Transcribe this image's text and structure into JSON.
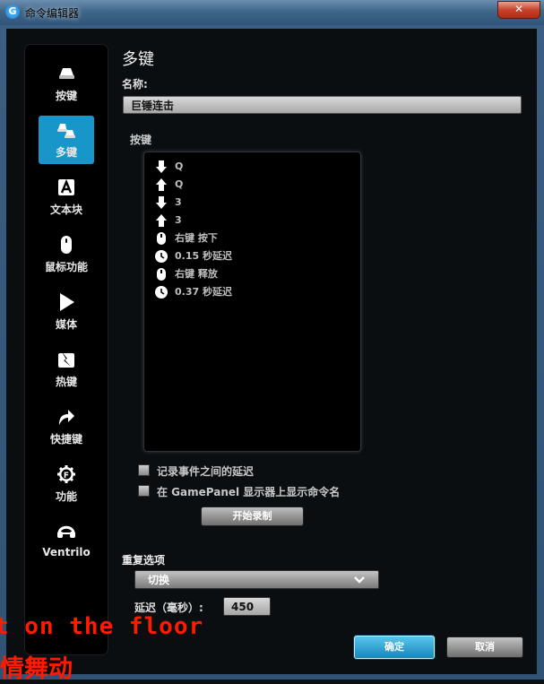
{
  "window": {
    "title": "命令编辑器",
    "logo": "G",
    "close": "✕"
  },
  "nav": [
    {
      "label": "按键",
      "icon": "key-icon",
      "selected": false
    },
    {
      "label": "多键",
      "icon": "multikey-icon",
      "selected": true
    },
    {
      "label": "文本块",
      "icon": "text-block-icon",
      "selected": false
    },
    {
      "label": "鼠标功能",
      "icon": "mouse-icon",
      "selected": false
    },
    {
      "label": "媒体",
      "icon": "play-icon",
      "selected": false
    },
    {
      "label": "热键",
      "icon": "hotkey-icon",
      "selected": false
    },
    {
      "label": "快捷键",
      "icon": "shortcut-arrow-icon",
      "selected": false
    },
    {
      "label": "功能",
      "icon": "function-gear-icon",
      "selected": false
    },
    {
      "label": "Ventrilo",
      "icon": "headset-icon",
      "selected": false
    }
  ],
  "main": {
    "heading": "多键",
    "name_label": "名称:",
    "name_value": "巨锤连击",
    "keys_label": "按键",
    "macro": [
      {
        "icon": "arrow-down-icon",
        "text": "Q"
      },
      {
        "icon": "arrow-up-icon",
        "text": "Q"
      },
      {
        "icon": "arrow-down-icon",
        "text": "3"
      },
      {
        "icon": "arrow-up-icon",
        "text": "3"
      },
      {
        "icon": "mouse-icon",
        "text": "右键 按下"
      },
      {
        "icon": "clock-icon",
        "text": "0.15 秒延迟"
      },
      {
        "icon": "mouse-icon",
        "text": "右键 释放"
      },
      {
        "icon": "clock-icon",
        "text": "0.37 秒延迟"
      }
    ],
    "record_delays": "记录事件之间的延迟",
    "show_on_gamepanel": "在 GamePanel 显示器上显示命令名",
    "start_record": "开始录制",
    "repeat_label": "重复选项",
    "repeat_value": "切换",
    "delay_label": "延迟（毫秒）:",
    "delay_value": "450",
    "ok": "确定",
    "cancel": "取消"
  },
  "overlay": {
    "line1": "t on the floor",
    "line2": "情舞动"
  },
  "colors": {
    "accent": "#1996c9",
    "overlay_text": "#ff1a00"
  }
}
